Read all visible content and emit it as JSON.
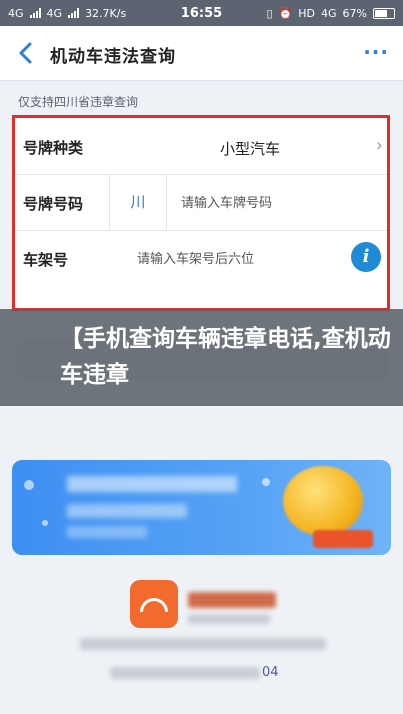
{
  "status_bar": {
    "network_left": "4G",
    "network_left2": "4G",
    "speed": "32.7K/s",
    "time": "16:55",
    "hd_label": "HD",
    "network_right": "4G",
    "battery_percent": "67%"
  },
  "nav": {
    "title": "机动车违法查询",
    "more_label": "···"
  },
  "notice": "仅支持四川省违章查询",
  "form": {
    "plate_type_label": "号牌种类",
    "plate_type_value": "小型汽车",
    "plate_number_label": "号牌号码",
    "province": "川",
    "plate_number_placeholder": "请输入车牌号码",
    "vin_label": "车架号",
    "vin_placeholder": "请输入车架号后六位"
  },
  "banner": {
    "text": "【手机查询车辆违章电话,查机动车违章"
  },
  "footer": {
    "number_fragment": "04"
  },
  "colors": {
    "accent_blue": "#2f7fd9",
    "highlight_red": "#e22b2b",
    "info_blue": "#1f8ad6",
    "promo_blue": "#3d8ff2",
    "logo_orange": "#f26a2e"
  },
  "icons": {
    "back": "chevron-left-icon",
    "more": "more-dots-icon",
    "chevron": "chevron-right-icon",
    "info": "info-icon"
  }
}
